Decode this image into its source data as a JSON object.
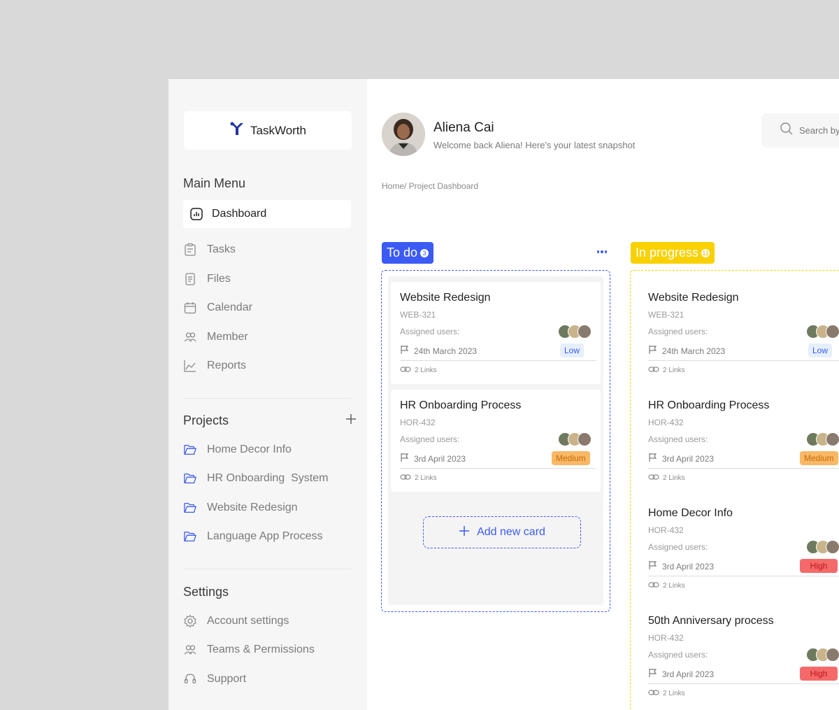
{
  "brand": {
    "name": "TaskWorth",
    "color": "#2034a8"
  },
  "sidebar": {
    "main_menu_title": "Main Menu",
    "main_items": [
      {
        "label": "Dashboard",
        "icon": "dashboard-icon",
        "active": true
      },
      {
        "label": "Tasks",
        "icon": "clipboard-icon"
      },
      {
        "label": "Files",
        "icon": "files-icon"
      },
      {
        "label": "Calendar",
        "icon": "calendar-icon"
      },
      {
        "label": "Member",
        "icon": "users-icon"
      },
      {
        "label": "Reports",
        "icon": "chart-line-icon"
      }
    ],
    "projects_title": "Projects",
    "projects": [
      {
        "label": "Home Decor Info",
        "icon": "folder-icon"
      },
      {
        "label": "HR Onboarding  System",
        "icon": "folder-icon"
      },
      {
        "label": "Website Redesign",
        "icon": "folder-icon"
      },
      {
        "label": "Language App Process",
        "icon": "folder-icon"
      }
    ],
    "settings_title": "Settings",
    "settings": [
      {
        "label": "Account settings",
        "icon": "gear-icon"
      },
      {
        "label": "Teams & Permissions",
        "icon": "users-icon"
      },
      {
        "label": "Support",
        "icon": "headset-icon"
      }
    ]
  },
  "header": {
    "user_name": "Aliena Cai",
    "welcome": "Welcome back Aliena! Here's your latest snapshot",
    "search_placeholder": "Search by",
    "breadcrumb": "Home/ Project Dashboard"
  },
  "columns": {
    "todo": {
      "label": "To do",
      "count": "3",
      "color": "#3b5bf4",
      "add_card_label": "Add new card",
      "cards": [
        {
          "title": "Website Redesign",
          "code": "WEB-321",
          "assigned": "Assigned users:",
          "date": "24th March 2023",
          "priority": "Low",
          "links": "2 Links"
        },
        {
          "title": "HR Onboarding Process",
          "code": "HOR-432",
          "assigned": "Assigned users:",
          "date": "3rd April 2023",
          "priority": "Medium",
          "links": "2 Links"
        }
      ]
    },
    "in_progress": {
      "label": "In progress",
      "count": "11",
      "color": "#f9d100",
      "cards": [
        {
          "title": "Website Redesign",
          "code": "WEB-321",
          "assigned": "Assigned users:",
          "date": "24th March 2023",
          "priority": "Low",
          "links": "2 Links"
        },
        {
          "title": "HR Onboarding Process",
          "code": "HOR-432",
          "assigned": "Assigned users:",
          "date": "3rd April 2023",
          "priority": "Medium",
          "links": "2 Links"
        },
        {
          "title": "Home Decor Info",
          "code": "HOR-432",
          "assigned": "Assigned users:",
          "date": "3rd April 2023",
          "priority": "High",
          "links": "2 Links"
        },
        {
          "title": "50th Anniversary process",
          "code": "HOR-432",
          "assigned": "Assigned users:",
          "date": "3rd April 2023",
          "priority": "High",
          "links": "2 Links"
        }
      ]
    }
  }
}
